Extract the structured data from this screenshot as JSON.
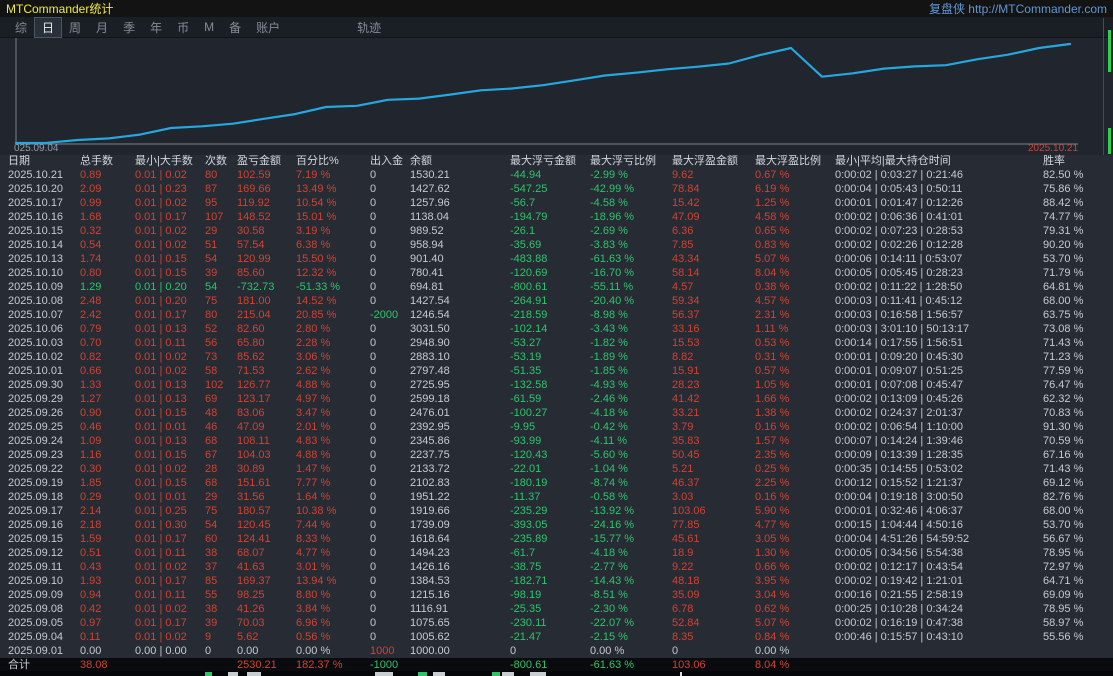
{
  "window": {
    "title": "MTCommander统计",
    "brand_link": "复盘侠 http://MTCommander.com"
  },
  "menu": {
    "items": [
      "综",
      "日",
      "周",
      "月",
      "季",
      "年",
      "币",
      "M",
      "备",
      "账户"
    ],
    "active_index": 1,
    "right_item": "轨迹"
  },
  "chart_data": {
    "type": "line",
    "title": "",
    "legend": "none",
    "grid": false,
    "line_color": "#25a8e0",
    "x_start_label": "025.09.04",
    "x_end_label": "2025.10.21",
    "ylim": [
      0,
      2530.21
    ],
    "x": [
      "2025.09.01",
      "2025.09.04",
      "2025.09.05",
      "2025.09.08",
      "2025.09.09",
      "2025.09.10",
      "2025.09.11",
      "2025.09.12",
      "2025.09.15",
      "2025.09.16",
      "2025.09.17",
      "2025.09.18",
      "2025.09.19",
      "2025.09.22",
      "2025.09.23",
      "2025.09.24",
      "2025.09.25",
      "2025.09.26",
      "2025.09.29",
      "2025.09.30",
      "2025.10.01",
      "2025.10.02",
      "2025.10.03",
      "2025.10.06",
      "2025.10.07",
      "2025.10.08",
      "2025.10.09",
      "2025.10.10",
      "2025.10.13",
      "2025.10.14",
      "2025.10.15",
      "2025.10.16",
      "2025.10.17",
      "2025.10.20",
      "2025.10.21"
    ],
    "series": [
      {
        "name": "累计盈亏",
        "values": [
          0,
          5.62,
          75.65,
          116.91,
          215.16,
          384.53,
          426.16,
          494.23,
          618.64,
          739.09,
          919.66,
          951.22,
          1102.83,
          1133.72,
          1237.75,
          1345.86,
          1392.95,
          1476.01,
          1599.18,
          1725.95,
          1797.48,
          1883.1,
          1948.9,
          2031.5,
          2246.54,
          2427.54,
          1694.81,
          1780.41,
          1901.4,
          1958.94,
          1989.52,
          2138.04,
          2257.96,
          2427.62,
          2530.21
        ]
      }
    ]
  },
  "table": {
    "headers": [
      "日期",
      "总手数",
      "最小|大手数",
      "次数",
      "盈亏金额",
      "百分比%",
      "出入金",
      "余额",
      "最大浮亏金额",
      "最大浮亏比例",
      "最大浮盈金额",
      "最大浮盈比例",
      "最小|平均|最大持仓时间",
      "胜率"
    ],
    "rows": [
      [
        "2025.10.21",
        "0.89",
        "0.01 | 0.02",
        "80",
        "102.59",
        "7.19 %",
        "0",
        "1530.21",
        "-44.94",
        "-2.99 %",
        "9.62",
        "0.67 %",
        "0:00:02 | 0:03:27 | 0:21:46",
        "82.50 %"
      ],
      [
        "2025.10.20",
        "2.09",
        "0.01 | 0.23",
        "87",
        "169.66",
        "13.49 %",
        "0",
        "1427.62",
        "-547.25",
        "-42.99 %",
        "78.84",
        "6.19 %",
        "0:00:04 | 0:05:43 | 0:50:11",
        "75.86 %"
      ],
      [
        "2025.10.17",
        "0.99",
        "0.01 | 0.02",
        "95",
        "119.92",
        "10.54 %",
        "0",
        "1257.96",
        "-56.7",
        "-4.58 %",
        "15.42",
        "1.25 %",
        "0:00:01 | 0:01:47 | 0:12:26",
        "88.42 %"
      ],
      [
        "2025.10.16",
        "1.68",
        "0.01 | 0.17",
        "107",
        "148.52",
        "15.01 %",
        "0",
        "1138.04",
        "-194.79",
        "-18.96 %",
        "47.09",
        "4.58 %",
        "0:00:02 | 0:06:36 | 0:41:01",
        "74.77 %"
      ],
      [
        "2025.10.15",
        "0.32",
        "0.01 | 0.02",
        "29",
        "30.58",
        "3.19 %",
        "0",
        "989.52",
        "-26.1",
        "-2.69 %",
        "6.36",
        "0.65 %",
        "0:00:02 | 0:07:23 | 0:28:53",
        "79.31 %"
      ],
      [
        "2025.10.14",
        "0.54",
        "0.01 | 0.02",
        "51",
        "57.54",
        "6.38 %",
        "0",
        "958.94",
        "-35.69",
        "-3.83 %",
        "7.85",
        "0.83 %",
        "0:00:02 | 0:02:26 | 0:12:28",
        "90.20 %"
      ],
      [
        "2025.10.13",
        "1.74",
        "0.01 | 0.15",
        "54",
        "120.99",
        "15.50 %",
        "0",
        "901.40",
        "-483.88",
        "-61.63 %",
        "43.34",
        "5.07 %",
        "0:00:06 | 0:14:11 | 0:53:07",
        "53.70 %"
      ],
      [
        "2025.10.10",
        "0.80",
        "0.01 | 0.15",
        "39",
        "85.60",
        "12.32 %",
        "0",
        "780.41",
        "-120.69",
        "-16.70 %",
        "58.14",
        "8.04 %",
        "0:00:05 | 0:05:45 | 0:28:23",
        "71.79 %"
      ],
      [
        "2025.10.09",
        "1.29",
        "0.01 | 0.20",
        "54",
        "-732.73",
        "-51.33 %",
        "0",
        "694.81",
        "-800.61",
        "-55.11 %",
        "4.57",
        "0.38 %",
        "0:00:02 | 0:11:22 | 1:28:50",
        "64.81 %"
      ],
      [
        "2025.10.08",
        "2.48",
        "0.01 | 0.20",
        "75",
        "181.00",
        "14.52 %",
        "0",
        "1427.54",
        "-264.91",
        "-20.40 %",
        "59.34",
        "4.57 %",
        "0:00:03 | 0:11:41 | 0:45:12",
        "68.00 %"
      ],
      [
        "2025.10.07",
        "2.42",
        "0.01 | 0.17",
        "80",
        "215.04",
        "20.85 %",
        "-2000",
        "1246.54",
        "-218.59",
        "-8.98 %",
        "56.37",
        "2.31 %",
        "0:00:03 | 0:16:58 | 1:56:57",
        "63.75 %"
      ],
      [
        "2025.10.06",
        "0.79",
        "0.01 | 0.13",
        "52",
        "82.60",
        "2.80 %",
        "0",
        "3031.50",
        "-102.14",
        "-3.43 %",
        "33.16",
        "1.11 %",
        "0:00:03 | 3:01:10 | 50:13:17",
        "73.08 %"
      ],
      [
        "2025.10.03",
        "0.70",
        "0.01 | 0.11",
        "56",
        "65.80",
        "2.28 %",
        "0",
        "2948.90",
        "-53.27",
        "-1.82 %",
        "15.53",
        "0.53 %",
        "0:00:14 | 0:17:55 | 1:56:51",
        "71.43 %"
      ],
      [
        "2025.10.02",
        "0.82",
        "0.01 | 0.02",
        "73",
        "85.62",
        "3.06 %",
        "0",
        "2883.10",
        "-53.19",
        "-1.89 %",
        "8.82",
        "0.31 %",
        "0:00:01 | 0:09:20 | 0:45:30",
        "71.23 %"
      ],
      [
        "2025.10.01",
        "0.66",
        "0.01 | 0.02",
        "58",
        "71.53",
        "2.62 %",
        "0",
        "2797.48",
        "-51.35",
        "-1.85 %",
        "15.91",
        "0.57 %",
        "0:00:01 | 0:09:07 | 0:51:25",
        "77.59 %"
      ],
      [
        "2025.09.30",
        "1.33",
        "0.01 | 0.13",
        "102",
        "126.77",
        "4.88 %",
        "0",
        "2725.95",
        "-132.58",
        "-4.93 %",
        "28.23",
        "1.05 %",
        "0:00:01 | 0:07:08 | 0:45:47",
        "76.47 %"
      ],
      [
        "2025.09.29",
        "1.27",
        "0.01 | 0.13",
        "69",
        "123.17",
        "4.97 %",
        "0",
        "2599.18",
        "-61.59",
        "-2.46 %",
        "41.42",
        "1.66 %",
        "0:00:02 | 0:13:09 | 0:45:26",
        "62.32 %"
      ],
      [
        "2025.09.26",
        "0.90",
        "0.01 | 0.15",
        "48",
        "83.06",
        "3.47 %",
        "0",
        "2476.01",
        "-100.27",
        "-4.18 %",
        "33.21",
        "1.38 %",
        "0:00:02 | 0:24:37 | 2:01:37",
        "70.83 %"
      ],
      [
        "2025.09.25",
        "0.46",
        "0.01 | 0.01",
        "46",
        "47.09",
        "2.01 %",
        "0",
        "2392.95",
        "-9.95",
        "-0.42 %",
        "3.79",
        "0.16 %",
        "0:00:02 | 0:06:54 | 1:10:00",
        "91.30 %"
      ],
      [
        "2025.09.24",
        "1.09",
        "0.01 | 0.13",
        "68",
        "108.11",
        "4.83 %",
        "0",
        "2345.86",
        "-93.99",
        "-4.11 %",
        "35.83",
        "1.57 %",
        "0:00:07 | 0:14:24 | 1:39:46",
        "70.59 %"
      ],
      [
        "2025.09.23",
        "1.16",
        "0.01 | 0.15",
        "67",
        "104.03",
        "4.88 %",
        "0",
        "2237.75",
        "-120.43",
        "-5.60 %",
        "50.45",
        "2.35 %",
        "0:00:09 | 0:13:39 | 1:28:35",
        "67.16 %"
      ],
      [
        "2025.09.22",
        "0.30",
        "0.01 | 0.02",
        "28",
        "30.89",
        "1.47 %",
        "0",
        "2133.72",
        "-22.01",
        "-1.04 %",
        "5.21",
        "0.25 %",
        "0:00:35 | 0:14:55 | 0:53:02",
        "71.43 %"
      ],
      [
        "2025.09.19",
        "1.85",
        "0.01 | 0.15",
        "68",
        "151.61",
        "7.77 %",
        "0",
        "2102.83",
        "-180.19",
        "-8.74 %",
        "46.37",
        "2.25 %",
        "0:00:12 | 0:15:52 | 1:21:37",
        "69.12 %"
      ],
      [
        "2025.09.18",
        "0.29",
        "0.01 | 0.01",
        "29",
        "31.56",
        "1.64 %",
        "0",
        "1951.22",
        "-11.37",
        "-0.58 %",
        "3.03",
        "0.16 %",
        "0:00:04 | 0:19:18 | 3:00:50",
        "82.76 %"
      ],
      [
        "2025.09.17",
        "2.14",
        "0.01 | 0.25",
        "75",
        "180.57",
        "10.38 %",
        "0",
        "1919.66",
        "-235.29",
        "-13.92 %",
        "103.06",
        "5.90 %",
        "0:00:01 | 0:32:46 | 4:06:37",
        "68.00 %"
      ],
      [
        "2025.09.16",
        "2.18",
        "0.01 | 0.30",
        "54",
        "120.45",
        "7.44 %",
        "0",
        "1739.09",
        "-393.05",
        "-24.16 %",
        "77.85",
        "4.77 %",
        "0:00:15 | 1:04:44 | 4:50:16",
        "53.70 %"
      ],
      [
        "2025.09.15",
        "1.59",
        "0.01 | 0.17",
        "60",
        "124.41",
        "8.33 %",
        "0",
        "1618.64",
        "-235.89",
        "-15.77 %",
        "45.61",
        "3.05 %",
        "0:00:04 | 4:51:26 | 54:59:52",
        "56.67 %"
      ],
      [
        "2025.09.12",
        "0.51",
        "0.01 | 0.11",
        "38",
        "68.07",
        "4.77 %",
        "0",
        "1494.23",
        "-61.7",
        "-4.18 %",
        "18.9",
        "1.30 %",
        "0:00:05 | 0:34:56 | 5:54:38",
        "78.95 %"
      ],
      [
        "2025.09.11",
        "0.43",
        "0.01 | 0.02",
        "37",
        "41.63",
        "3.01 %",
        "0",
        "1426.16",
        "-38.75",
        "-2.77 %",
        "9.22",
        "0.66 %",
        "0:00:02 | 0:12:17 | 0:43:54",
        "72.97 %"
      ],
      [
        "2025.09.10",
        "1.93",
        "0.01 | 0.17",
        "85",
        "169.37",
        "13.94 %",
        "0",
        "1384.53",
        "-182.71",
        "-14.43 %",
        "48.18",
        "3.95 %",
        "0:00:02 | 0:19:42 | 1:21:01",
        "64.71 %"
      ],
      [
        "2025.09.09",
        "0.94",
        "0.01 | 0.11",
        "55",
        "98.25",
        "8.80 %",
        "0",
        "1215.16",
        "-98.19",
        "-8.51 %",
        "35.09",
        "3.04 %",
        "0:00:16 | 0:21:55 | 2:58:19",
        "69.09 %"
      ],
      [
        "2025.09.08",
        "0.42",
        "0.01 | 0.02",
        "38",
        "41.26",
        "3.84 %",
        "0",
        "1116.91",
        "-25.35",
        "-2.30 %",
        "6.78",
        "0.62 %",
        "0:00:25 | 0:10:28 | 0:34:24",
        "78.95 %"
      ],
      [
        "2025.09.05",
        "0.97",
        "0.01 | 0.17",
        "39",
        "70.03",
        "6.96 %",
        "0",
        "1075.65",
        "-230.11",
        "-22.07 %",
        "52.84",
        "5.07 %",
        "0:00:02 | 0:16:19 | 0:47:38",
        "58.97 %"
      ],
      [
        "2025.09.04",
        "0.11",
        "0.01 | 0.02",
        "9",
        "5.62",
        "0.56 %",
        "0",
        "1005.62",
        "-21.47",
        "-2.15 %",
        "8.35",
        "0.84 %",
        "0:00:46 | 0:15:57 | 0:43:10",
        "55.56 %"
      ],
      [
        "2025.09.01",
        "0.00",
        "0.00 | 0.00",
        "0",
        "0.00",
        "0.00 %",
        "1000",
        "1000.00",
        "0",
        "0.00 %",
        "0",
        "0.00 %",
        "",
        ""
      ]
    ],
    "total_row": [
      "合计",
      "38.08",
      "",
      "",
      "2530.21",
      "182.37 %",
      "-1000",
      "",
      "-800.61",
      "-61.63 %",
      "103.06",
      "8.04 %",
      "",
      ""
    ]
  },
  "colors": {
    "profit_text": "#cf4433",
    "loss_text": "#2fc46c",
    "neutral_text": "#c6cbd2",
    "equity_line": "#25a8e0",
    "title_text": "#f0ec3d",
    "link_text": "#5e97d5",
    "background": "#262b34",
    "chart_background": "#20252e"
  }
}
